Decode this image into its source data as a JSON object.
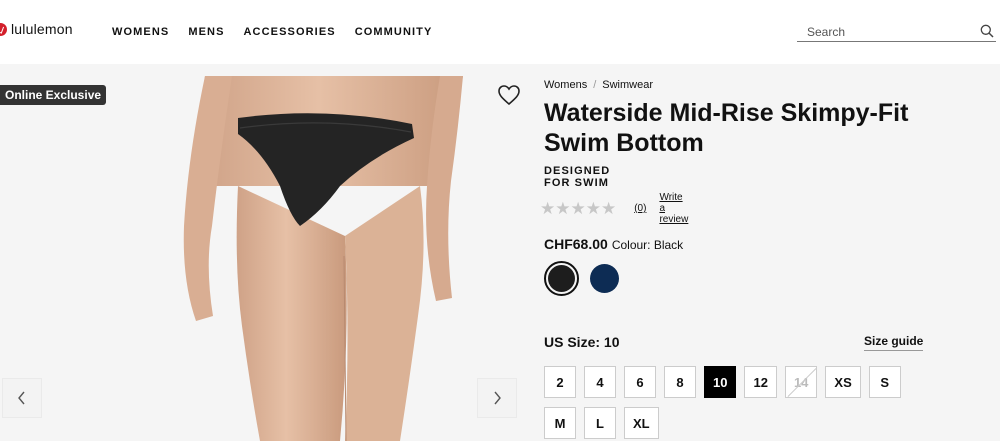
{
  "brand": {
    "name": "lululemon",
    "color": "#d31f2b"
  },
  "nav": [
    "WOMENS",
    "MENS",
    "ACCESSORIES",
    "COMMUNITY"
  ],
  "search": {
    "placeholder": "Search",
    "icon": "search-icon"
  },
  "gallery": {
    "badge": "Online Exclusive",
    "wishlist_icon": "heart-icon",
    "prev_icon": "chevron-left-icon",
    "next_icon": "chevron-right-icon"
  },
  "product": {
    "breadcrumb": [
      "Womens",
      "Swimwear"
    ],
    "title": "Waterside Mid-Rise Skimpy-Fit Swim Bottom",
    "subtitle": "DESIGNED FOR SWIM",
    "rating": {
      "stars": "★★★★★",
      "count": "(0)",
      "review_link": "Write a review"
    },
    "price": "CHF68.00",
    "colour_label": "Colour: Black",
    "swatches": [
      {
        "name": "Black",
        "color": "#1d1d1d",
        "selected": true
      },
      {
        "name": "Navy",
        "color": "#0d2c54",
        "selected": false
      }
    ],
    "size_label": "US Size: 10",
    "size_guide": "Size guide",
    "sizes": [
      {
        "label": "2",
        "state": "available"
      },
      {
        "label": "4",
        "state": "available"
      },
      {
        "label": "6",
        "state": "available"
      },
      {
        "label": "8",
        "state": "available"
      },
      {
        "label": "10",
        "state": "selected"
      },
      {
        "label": "12",
        "state": "available"
      },
      {
        "label": "14",
        "state": "unavailable"
      },
      {
        "label": "XS",
        "state": "available"
      },
      {
        "label": "S",
        "state": "available"
      },
      {
        "label": "M",
        "state": "available"
      },
      {
        "label": "L",
        "state": "available"
      },
      {
        "label": "XL",
        "state": "available"
      }
    ]
  }
}
